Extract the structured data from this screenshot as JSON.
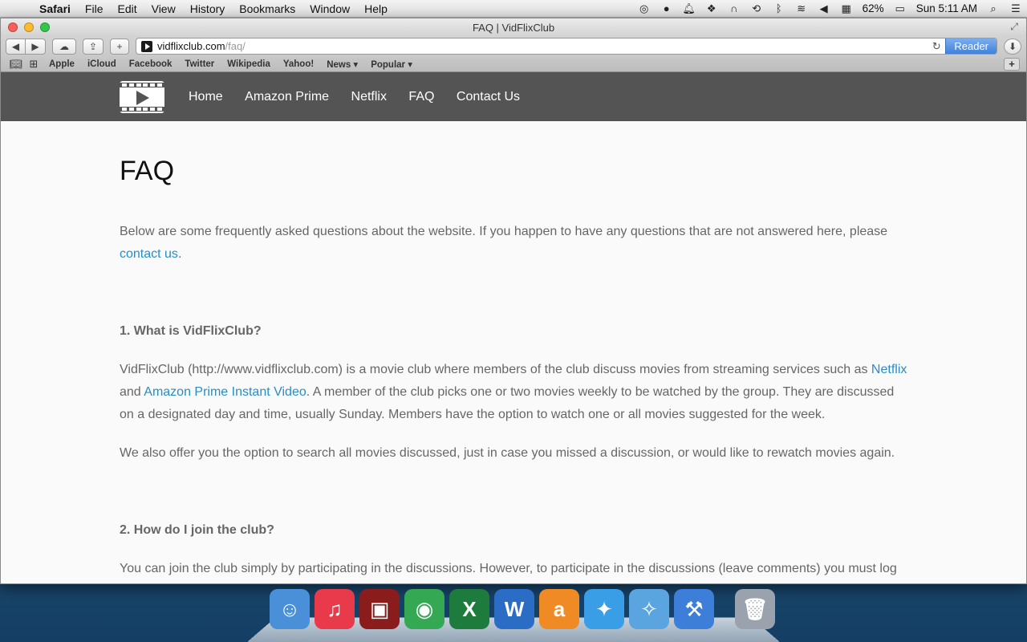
{
  "menubar": {
    "app_name": "Safari",
    "items": [
      "File",
      "Edit",
      "View",
      "History",
      "Bookmarks",
      "Window",
      "Help"
    ],
    "battery": "62%",
    "clock": "Sun 5:11 AM"
  },
  "window": {
    "title": "FAQ | VidFlixClub",
    "url_host": "vidflixclub.com",
    "url_path": "/faq/",
    "reader_label": "Reader"
  },
  "bookmarks": [
    "Apple",
    "iCloud",
    "Facebook",
    "Twitter",
    "Wikipedia",
    "Yahoo!",
    "News ▾",
    "Popular ▾"
  ],
  "site": {
    "nav": [
      "Home",
      "Amazon Prime",
      "Netflix",
      "FAQ",
      "Contact Us"
    ]
  },
  "page": {
    "heading": "FAQ",
    "intro_text": "Below are some frequently asked questions about the website. If you happen to have any questions that are not answered here, please ",
    "intro_link": "contact us",
    "intro_end": ".",
    "q1_title": "1. What is VidFlixClub?",
    "q1_p1_a": "VidFlixClub (http://www.vidflixclub.com) is a movie club where members of the club discuss movies from streaming services such as ",
    "q1_link_netflix": "Netflix",
    "q1_p1_b": " and ",
    "q1_link_amazon": "Amazon Prime Instant Video",
    "q1_p1_c": ". A member of the club picks one or two movies weekly to be watched by the group. They are discussed on a designated day and time, usually Sunday. Members have the option to watch one or all movies suggested for the week.",
    "q1_p2": "We also offer you the option to search all movies discussed, just in case you missed a discussion, or would like to rewatch movies again.",
    "q2_title": "2. How do I join the club?",
    "q2_p1": "You can join the club simply by participating in the discussions. However, to participate in the discussions (leave comments) you must log on with either your WordPress, Twitter, Facebook, Google+, or Instagram account."
  },
  "dock": {
    "apps": [
      {
        "icon": "finder-icon",
        "color": "#4a90d9"
      },
      {
        "icon": "itunes-icon",
        "color": "#e83a4a"
      },
      {
        "icon": "photo-booth-icon",
        "color": "#8a1c1c"
      },
      {
        "icon": "chrome-icon",
        "color": "#34a853"
      },
      {
        "icon": "excel-icon",
        "color": "#1e7b3e"
      },
      {
        "icon": "word-icon",
        "color": "#2b6cc4"
      },
      {
        "icon": "amazon-mp3-icon",
        "color": "#f08a24"
      },
      {
        "icon": "twitter-icon",
        "color": "#3a9ee6"
      },
      {
        "icon": "safari-icon",
        "color": "#5aa5e0"
      },
      {
        "icon": "xcode-icon",
        "color": "#3d7fd8"
      },
      {
        "icon": "trash-icon",
        "color": "#9aa3ad"
      }
    ]
  }
}
